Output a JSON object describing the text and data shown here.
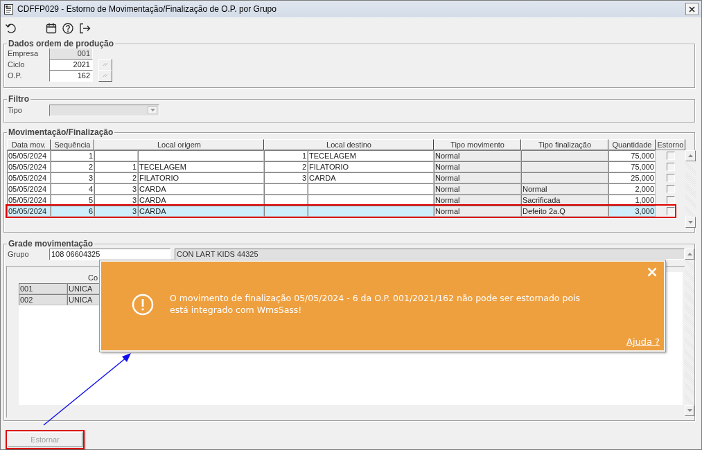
{
  "window": {
    "title": "CDFFP029 - Estorno de Movimentação/Finalização de O.P. por Grupo"
  },
  "toolbar": [
    {
      "kind": "undo"
    },
    {
      "kind": "calendar"
    },
    {
      "kind": "help"
    },
    {
      "kind": "exit"
    }
  ],
  "dados": {
    "legend": "Dados ordem de produção",
    "fields": [
      {
        "label": "Empresa",
        "value": "001",
        "disabled": true,
        "lookup": false
      },
      {
        "label": "Ciclo",
        "value": "2021",
        "disabled": false,
        "lookup": true
      },
      {
        "label": "O.P.",
        "value": "162",
        "disabled": false,
        "lookup": true
      }
    ]
  },
  "filtro": {
    "legend": "Filtro",
    "tipo": {
      "label": "Tipo",
      "disabled": true
    }
  },
  "movimentacao": {
    "legend": "Movimentação/Finalização",
    "columns": [
      "Data mov.",
      "Sequência",
      "Local origem",
      "Local destino",
      "Tipo movimento",
      "Tipo finalização",
      "Quantidade",
      "Estorno"
    ],
    "rows": [
      {
        "data_mov": "05/05/2024",
        "sequencia": "1",
        "origem_codigo": "",
        "origem": "",
        "destino_codigo": "1",
        "destino": "TECELAGEM",
        "tipo_movimento": "Normal",
        "tipo_finalizacao": "",
        "quantidade": "75,000",
        "estorno": false,
        "selected": false
      },
      {
        "data_mov": "05/05/2024",
        "sequencia": "2",
        "origem_codigo": "1",
        "origem": "TECELAGEM",
        "destino_codigo": "2",
        "destino": "FILATORIO",
        "tipo_movimento": "Normal",
        "tipo_finalizacao": "",
        "quantidade": "75,000",
        "estorno": false,
        "selected": false
      },
      {
        "data_mov": "05/05/2024",
        "sequencia": "3",
        "origem_codigo": "2",
        "origem": "FILATORIO",
        "destino_codigo": "3",
        "destino": "CARDA",
        "tipo_movimento": "Normal",
        "tipo_finalizacao": "",
        "quantidade": "25,000",
        "estorno": false,
        "selected": false
      },
      {
        "data_mov": "05/05/2024",
        "sequencia": "4",
        "origem_codigo": "3",
        "origem": "CARDA",
        "destino_codigo": "",
        "destino": "",
        "tipo_movimento": "Normal",
        "tipo_finalizacao": "Normal",
        "quantidade": "2,000",
        "estorno": false,
        "selected": false
      },
      {
        "data_mov": "05/05/2024",
        "sequencia": "5",
        "origem_codigo": "3",
        "origem": "CARDA",
        "destino_codigo": "",
        "destino": "",
        "tipo_movimento": "Normal",
        "tipo_finalizacao": "Sacrificada",
        "quantidade": "1,000",
        "estorno": false,
        "selected": false
      },
      {
        "data_mov": "05/05/2024",
        "sequencia": "6",
        "origem_codigo": "3",
        "origem": "CARDA",
        "destino_codigo": "",
        "destino": "",
        "tipo_movimento": "Normal",
        "tipo_finalizacao": "Defeito 2a.Q",
        "quantidade": "3,000",
        "estorno": false,
        "selected": true
      }
    ]
  },
  "grade": {
    "legend": "Grade movimentação",
    "grupo": {
      "label": "Grupo",
      "value": "108 06604325",
      "description": "CON LART KIDS 44325"
    },
    "grid": {
      "columns": [
        "",
        "Co"
      ],
      "rows": [
        [
          "001",
          "UNICA"
        ],
        [
          "002",
          "UNICA"
        ]
      ]
    }
  },
  "toast": {
    "message": "O movimento de finalização 05/05/2024 - 6 da O.P. 001/2021/162 não pode ser estornado pois está integrado com WmsSass!",
    "link": "Ajuda ?"
  },
  "buttons": [
    {
      "label": "Estornar",
      "disabled": true
    }
  ]
}
